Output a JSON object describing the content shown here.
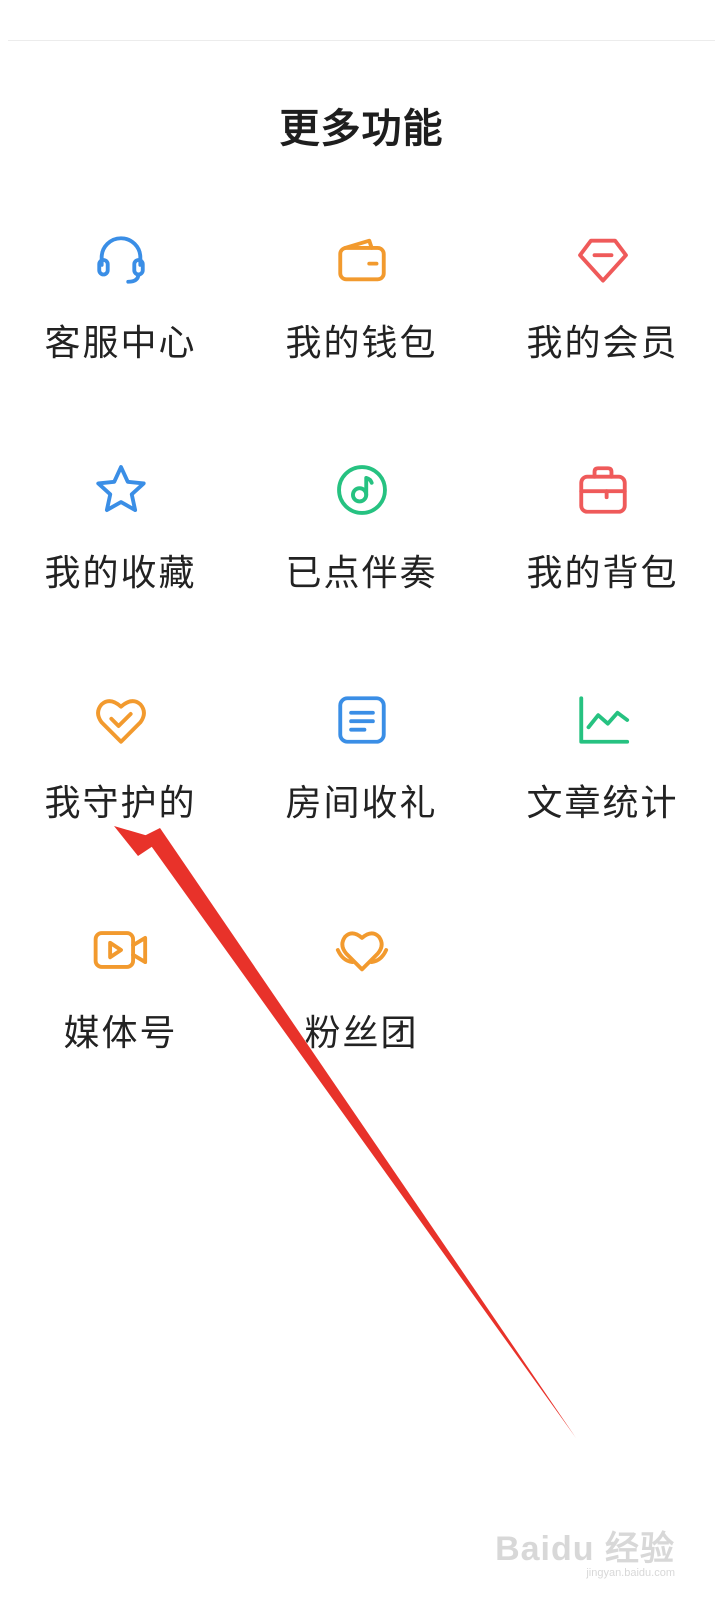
{
  "header": {
    "title": "更多功能"
  },
  "rows": [
    [
      {
        "label": "客服中心",
        "icon": "headset-icon",
        "color": "#3a8ee6"
      },
      {
        "label": "我的钱包",
        "icon": "wallet-icon",
        "color": "#f29a2e"
      },
      {
        "label": "我的会员",
        "icon": "gem-icon",
        "color": "#ef5a5a"
      }
    ],
    [
      {
        "label": "我的收藏",
        "icon": "star-icon",
        "color": "#3a8ee6"
      },
      {
        "label": "已点伴奏",
        "icon": "music-disc-icon",
        "color": "#26c281"
      },
      {
        "label": "我的背包",
        "icon": "backpack-icon",
        "color": "#ef5a5a"
      }
    ],
    [
      {
        "label": "我守护的",
        "icon": "heart-check-icon",
        "color": "#f29a2e"
      },
      {
        "label": "房间收礼",
        "icon": "list-card-icon",
        "color": "#3a8ee6"
      },
      {
        "label": "文章统计",
        "icon": "line-chart-icon",
        "color": "#26c281"
      }
    ],
    [
      {
        "label": "媒体号",
        "icon": "video-camera-icon",
        "color": "#f29a2e"
      },
      {
        "label": "粉丝团",
        "icon": "heart-hands-icon",
        "color": "#f29a2e"
      }
    ]
  ],
  "annotation": {
    "color": "#e8322a"
  },
  "watermark": {
    "logo": "Baidu 经验",
    "url": "jingyan.baidu.com"
  }
}
